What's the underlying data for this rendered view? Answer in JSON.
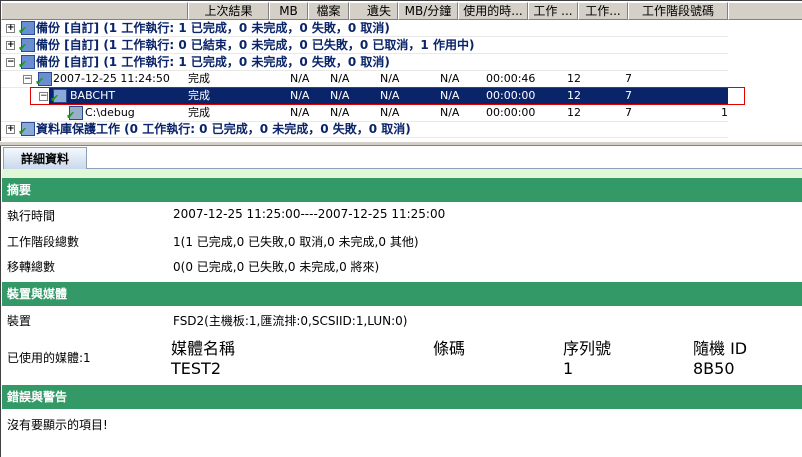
{
  "columns": [
    "",
    "上次結果",
    "MB",
    "檔案",
    "遺失",
    "MB/分鐘",
    "使用的時...",
    "工作 ...",
    "工作...",
    "工作階段號碼",
    ""
  ],
  "rows": [
    {
      "type": "group",
      "expander": "+",
      "label": "備份 [自訂] (1 工作執行: 1 已完成，0 未完成，0 失敗，0 取消)"
    },
    {
      "type": "group",
      "expander": "+",
      "label": "備份 [自訂] (1 工作執行: 0 已結束，0 未完成，0 已失敗，0 已取消，1 作用中)"
    },
    {
      "type": "group",
      "expander": "−",
      "label": "備份 [自訂] (1 工作執行: 1 已完成，0 未完成，0 失敗，0 取消)"
    },
    {
      "type": "item",
      "expander": "−",
      "name": "2007-12-25 11:24:50",
      "result": "完成",
      "mb": "N/A",
      "files": "N/A",
      "missing": "N/A",
      "rate": "N/A",
      "time": "00:00:46",
      "c7": "12",
      "c8": "7",
      "session": ""
    },
    {
      "type": "item",
      "expander": "−",
      "name": "BABCHT",
      "result": "完成",
      "mb": "N/A",
      "files": "N/A",
      "missing": "N/A",
      "rate": "N/A",
      "time": "00:00:00",
      "c7": "12",
      "c8": "7",
      "session": "",
      "selected": true
    },
    {
      "type": "item",
      "expander": "",
      "name": "C:\\debug",
      "result": "完成",
      "mb": "N/A",
      "files": "N/A",
      "missing": "N/A",
      "rate": "N/A",
      "time": "00:00:00",
      "c7": "12",
      "c8": "7",
      "session": "1"
    },
    {
      "type": "group",
      "expander": "+",
      "label": "資料庫保護工作 (0 工作執行: 0 已完成，0 未完成，0 失敗，0 取消)"
    }
  ],
  "details": {
    "tab": "詳細資料",
    "summary": {
      "title": "摘要",
      "run_time_label": "執行時間",
      "run_time": "2007-12-25 11:25:00----2007-12-25 11:25:00",
      "sessions_label": "工作階段總數",
      "sessions": "1(1 已完成,0 已失敗,0 取消,0 未完成,0 其他)",
      "migrations_label": "移轉總數",
      "migrations": "0(0 已完成,0 已失敗,0 未完成,0 將來)"
    },
    "devices": {
      "title": "裝置與媒體",
      "device_label": "裝置",
      "device": "FSD2(主機板:1,匯流排:0,SCSIID:1,LUN:0)",
      "media_used_label": "已使用的媒體:1",
      "media_headers": [
        "媒體名稱",
        "條碼",
        "序列號",
        "隨機 ID"
      ],
      "media_values": [
        "TEST2",
        "",
        "1",
        "8B50"
      ]
    },
    "errors": {
      "title": "錯誤與警告",
      "message": "沒有要顯示的項目!"
    }
  }
}
